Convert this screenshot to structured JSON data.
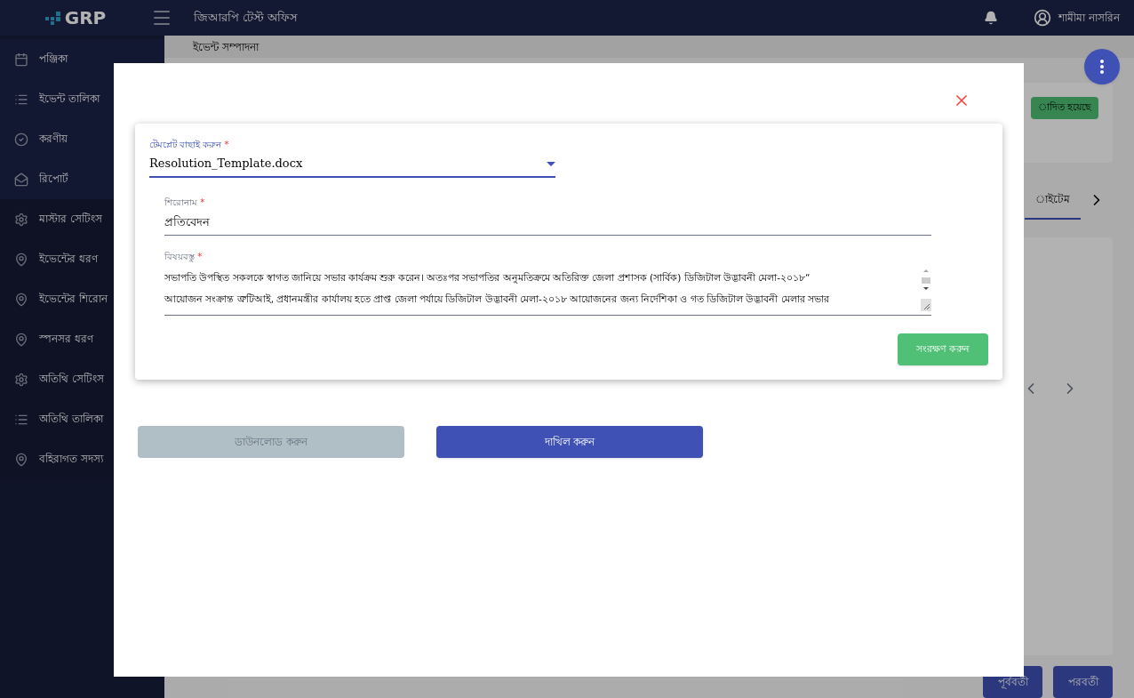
{
  "header": {
    "logo": "GRP",
    "office": "জিআরপি টেস্ট অফিস",
    "user": "শামীমা নাসরিন"
  },
  "sidebar": {
    "items": [
      {
        "label": "পঞ্জিকা",
        "kind": "calendar"
      },
      {
        "label": "ইভেন্ট তালিকা",
        "kind": "list"
      },
      {
        "label": "করণীয়",
        "kind": "check"
      },
      {
        "label": "রিপোর্ট",
        "kind": "mail"
      },
      {
        "label": "মাস্টার সেটিংস",
        "kind": "gear"
      },
      {
        "label": "ইভেন্টের ধরণ",
        "kind": "pin"
      },
      {
        "label": "ইভেন্টের শিরোন",
        "kind": "pin"
      },
      {
        "label": "স্পনসর ধরণ",
        "kind": "pin"
      },
      {
        "label": "অতিথি সেটিংস",
        "kind": "gear"
      },
      {
        "label": "অতিথি তালিকা",
        "kind": "list"
      },
      {
        "label": "বহিরাগত সদস্য",
        "kind": "pin"
      }
    ]
  },
  "page": {
    "breadcrumb": "ইভেন্ট সম্পাদনা",
    "status_badge": "াদিত হয়েছে",
    "tab": "াইটেম",
    "buttons": [
      "পূর্ববর্তী",
      "পরবর্তী"
    ]
  },
  "modal": {
    "template": {
      "label": "টেমপ্লেট বাছাই করুন",
      "required": "*",
      "value": "Resolution_Template.docx"
    },
    "title": {
      "label": "শিরোনাম",
      "required": "*",
      "value": "প্রতিবেদন"
    },
    "subject": {
      "label": "বিষয়বস্তু",
      "required": "*",
      "lines": [
        "সভাপতি উপস্থিত সকলকে স্বাগত জানিয়ে সভার কার্যক্রম শুরু করেন। অতঃপর সভাপতির অনুমতিক্রমে অতিরিক্ত জেলা প্রশাসক (সার্বিক)  ডিজিটাল উদ্ভাবনী মেলা-২০১৮“",
        "আয়োজন সংক্রান্ত ত্রুটিআই, প্রধানমন্ত্রীর কার্যালয় হতে প্রাপ্ত জেলা পর্যায়ে ডিজিটাল উদ্ভাবনী মেলা-২০১৮ আয়োজনের জন্য নির্দেশিকা ও গত ডিজিটাল উদ্ভাবনী মেলার সভার"
      ]
    },
    "save_button": "সংরক্ষণ করুন",
    "actions": [
      {
        "label": "ডাউনলোড করুন",
        "disabled": true
      },
      {
        "label": "দাখিল করুন",
        "disabled": false
      }
    ]
  }
}
